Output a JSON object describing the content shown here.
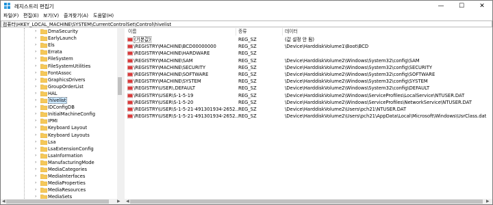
{
  "window": {
    "title": "레지스트리 편집기"
  },
  "controls": {
    "minimize": "—",
    "maximize": "☐",
    "close": "✕"
  },
  "menu": [
    "파일(F)",
    "편집(E)",
    "보기(V)",
    "즐겨찾기(A)",
    "도움말(H)"
  ],
  "address": "컴퓨터\\HKEY_LOCAL_MACHINE\\SYSTEM\\CurrentControlSet\\Control\\hivelist",
  "tree": {
    "items": [
      "DmaSecurity",
      "EarlyLaunch",
      "Els",
      "Errata",
      "FileSystem",
      "FileSystemUtilities",
      "FontAssoc",
      "GraphicsDrivers",
      "GroupOrderList",
      "HAL",
      "hivelist",
      "IDConfigDB",
      "InitialMachineConfig",
      "IPMI",
      "Keyboard Layout",
      "Keyboard Layouts",
      "Lsa",
      "LsaExtensionConfig",
      "LsaInformation",
      "ManufacturingMode",
      "MediaCategories",
      "MediaInterfaces",
      "MediaProperties",
      "MediaResources",
      "MediaSets"
    ],
    "selected": "hivelist"
  },
  "columns": {
    "name": "이름",
    "type": "종류",
    "data": "데이터"
  },
  "rows": [
    {
      "name": "(기본값)",
      "type": "REG_SZ",
      "data": "(값 설정 안 됨)"
    },
    {
      "name": "\\REGISTRY\\MACHINE\\BCD00000000",
      "type": "REG_SZ",
      "data": "\\Device\\HarddiskVolume1\\Boot\\BCD"
    },
    {
      "name": "\\REGISTRY\\MACHINE\\HARDWARE",
      "type": "REG_SZ",
      "data": ""
    },
    {
      "name": "\\REGISTRY\\MACHINE\\SAM",
      "type": "REG_SZ",
      "data": "\\Device\\HarddiskVolume2\\Windows\\System32\\config\\SAM"
    },
    {
      "name": "\\REGISTRY\\MACHINE\\SECURITY",
      "type": "REG_SZ",
      "data": "\\Device\\HarddiskVolume2\\Windows\\System32\\config\\SECURITY"
    },
    {
      "name": "\\REGISTRY\\MACHINE\\SOFTWARE",
      "type": "REG_SZ",
      "data": "\\Device\\HarddiskVolume2\\Windows\\System32\\config\\SOFTWARE"
    },
    {
      "name": "\\REGISTRY\\MACHINE\\SYSTEM",
      "type": "REG_SZ",
      "data": "\\Device\\HarddiskVolume2\\Windows\\System32\\config\\SYSTEM"
    },
    {
      "name": "\\REGISTRY\\USER\\.DEFAULT",
      "type": "REG_SZ",
      "data": "\\Device\\HarddiskVolume2\\Windows\\System32\\config\\DEFAULT"
    },
    {
      "name": "\\REGISTRY\\USER\\S-1-5-19",
      "type": "REG_SZ",
      "data": "\\Device\\HarddiskVolume2\\Windows\\ServiceProfiles\\LocalService\\NTUSER.DAT"
    },
    {
      "name": "\\REGISTRY\\USER\\S-1-5-20",
      "type": "REG_SZ",
      "data": "\\Device\\HarddiskVolume2\\Windows\\ServiceProfiles\\NetworkService\\NTUSER.DAT"
    },
    {
      "name": "\\REGISTRY\\USER\\S-1-5-21-491301934-2652...",
      "type": "REG_SZ",
      "data": "\\Device\\HarddiskVolume2\\Users\\pch21\\NTUSER.DAT"
    },
    {
      "name": "\\REGISTRY\\USER\\S-1-5-21-491301934-2652...",
      "type": "REG_SZ",
      "data": "\\Device\\HarddiskVolume2\\Users\\pch21\\AppData\\Local\\Microsoft\\Windows\\UsrClass.dat"
    }
  ]
}
